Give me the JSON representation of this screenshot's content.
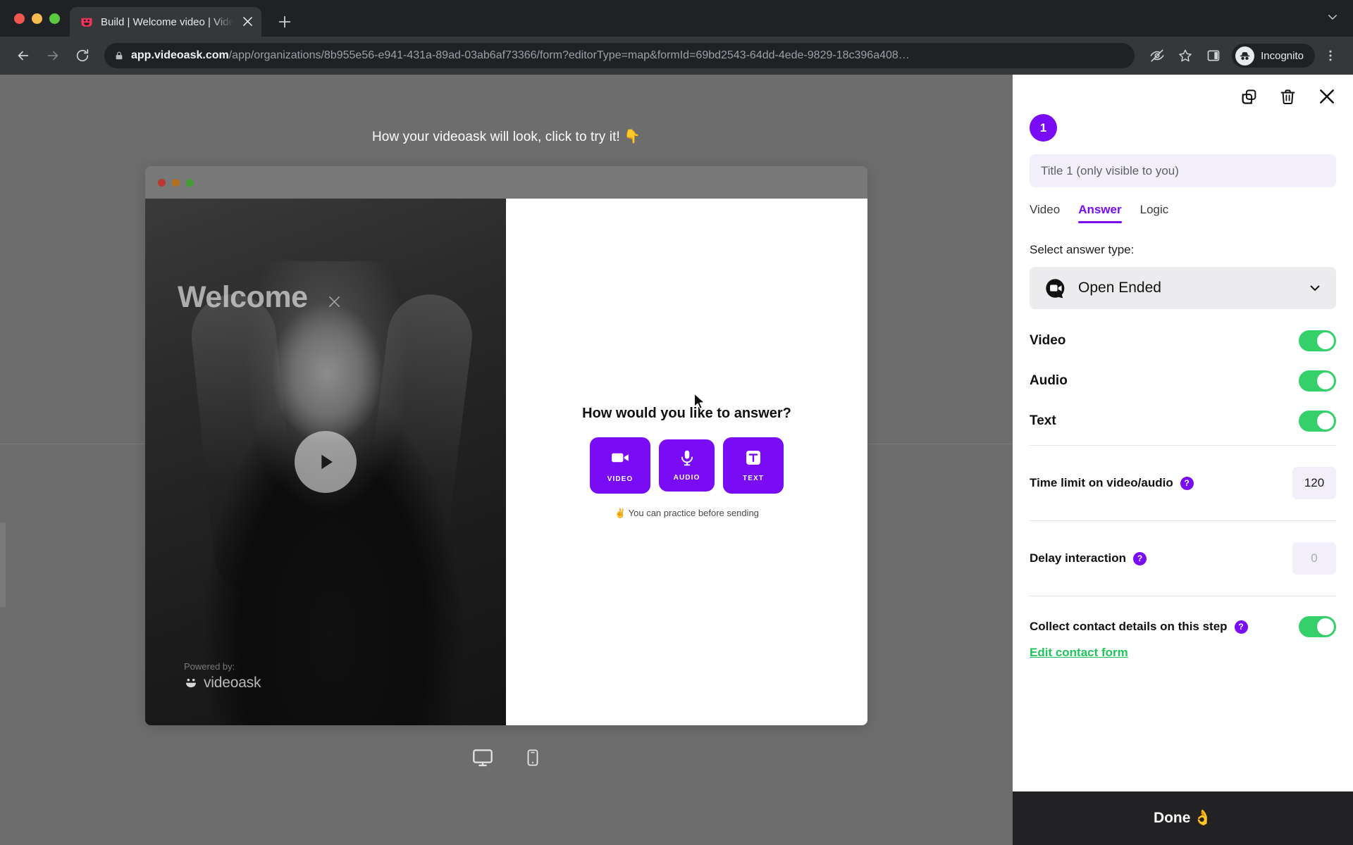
{
  "browser": {
    "tab": {
      "title": "Build | Welcome video | VideoAsk",
      "favicon": "videoask-smiley-icon",
      "close_icon": "close-icon"
    },
    "new_tab_icon": "plus-icon",
    "tabstrip_menu_icon": "chevron-down-icon",
    "nav": {
      "back_icon": "back-arrow-icon",
      "forward_icon": "forward-arrow-icon",
      "reload_icon": "reload-icon"
    },
    "omnibox": {
      "lock_icon": "lock-icon",
      "host": "app.videoask.com",
      "path": "/app/organizations/8b955e56-e941-431a-89ad-03ab6af73366/form?editorType=map&formId=69bd2543-64dd-4ede-9829-18c396a408…"
    },
    "toolbar_icons": {
      "tracking_protection": "eye-off-icon",
      "bookmark": "star-icon",
      "side_panel": "side-panel-icon",
      "menu": "kebab-menu-icon"
    },
    "profile": {
      "label": "Incognito",
      "avatar_icon": "incognito-hat-icon"
    }
  },
  "stage": {
    "caption": "How your videoask will look, click to try it!",
    "caption_emoji": "👇",
    "preview": {
      "window_dots": [
        "red",
        "yellow",
        "green"
      ],
      "video": {
        "title": "Welcome",
        "title_remove_icon": "close-icon",
        "play_icon": "play-icon",
        "powered_label": "Powered by:",
        "brand_name": "videoask",
        "brand_icon": "videoask-smiley-icon"
      },
      "answer": {
        "question": "How would you like to answer?",
        "options": [
          {
            "label": "VIDEO",
            "icon": "video-camera-icon"
          },
          {
            "label": "AUDIO",
            "icon": "microphone-icon"
          },
          {
            "label": "TEXT",
            "icon": "text-box-icon"
          }
        ],
        "note": "✌️ You can practice before sending",
        "note_text": "You can practice before sending"
      }
    },
    "device_toggles": [
      {
        "name": "desktop",
        "icon": "monitor-icon"
      },
      {
        "name": "mobile",
        "icon": "phone-icon"
      }
    ]
  },
  "panel": {
    "step_number": "1",
    "actions": [
      {
        "name": "duplicate",
        "icon": "copy-icon"
      },
      {
        "name": "delete",
        "icon": "trash-icon"
      },
      {
        "name": "close",
        "icon": "close-icon"
      }
    ],
    "title_placeholder": "Title 1 (only visible to you)",
    "title_value": "",
    "tabs": [
      {
        "label": "Video",
        "active": false
      },
      {
        "label": "Answer",
        "active": true
      },
      {
        "label": "Logic",
        "active": false
      }
    ],
    "answer_type": {
      "label": "Select answer type:",
      "selected": "Open Ended",
      "icon": "speech-bubble-video-icon",
      "chevron_icon": "chevron-down-icon"
    },
    "media_toggles": [
      {
        "label": "Video",
        "on": true
      },
      {
        "label": "Audio",
        "on": true
      },
      {
        "label": "Text",
        "on": true
      }
    ],
    "time_limit": {
      "label": "Time limit on video/audio",
      "help_icon": "question-mark-icon",
      "value": "120"
    },
    "delay": {
      "label": "Delay interaction",
      "help_icon": "question-mark-icon",
      "placeholder": "0"
    },
    "collect_contact": {
      "label": "Collect contact details on this step",
      "help_icon": "question-mark-icon",
      "on": true,
      "edit_link": "Edit contact form"
    },
    "done_button": "Done",
    "done_emoji": "👌"
  },
  "colors": {
    "brand_purple": "#7a0bf5",
    "toggle_green": "#35d06a",
    "link_green": "#21c55d",
    "stage_gray": "#6d6d6d",
    "chrome_dark": "#202124"
  }
}
